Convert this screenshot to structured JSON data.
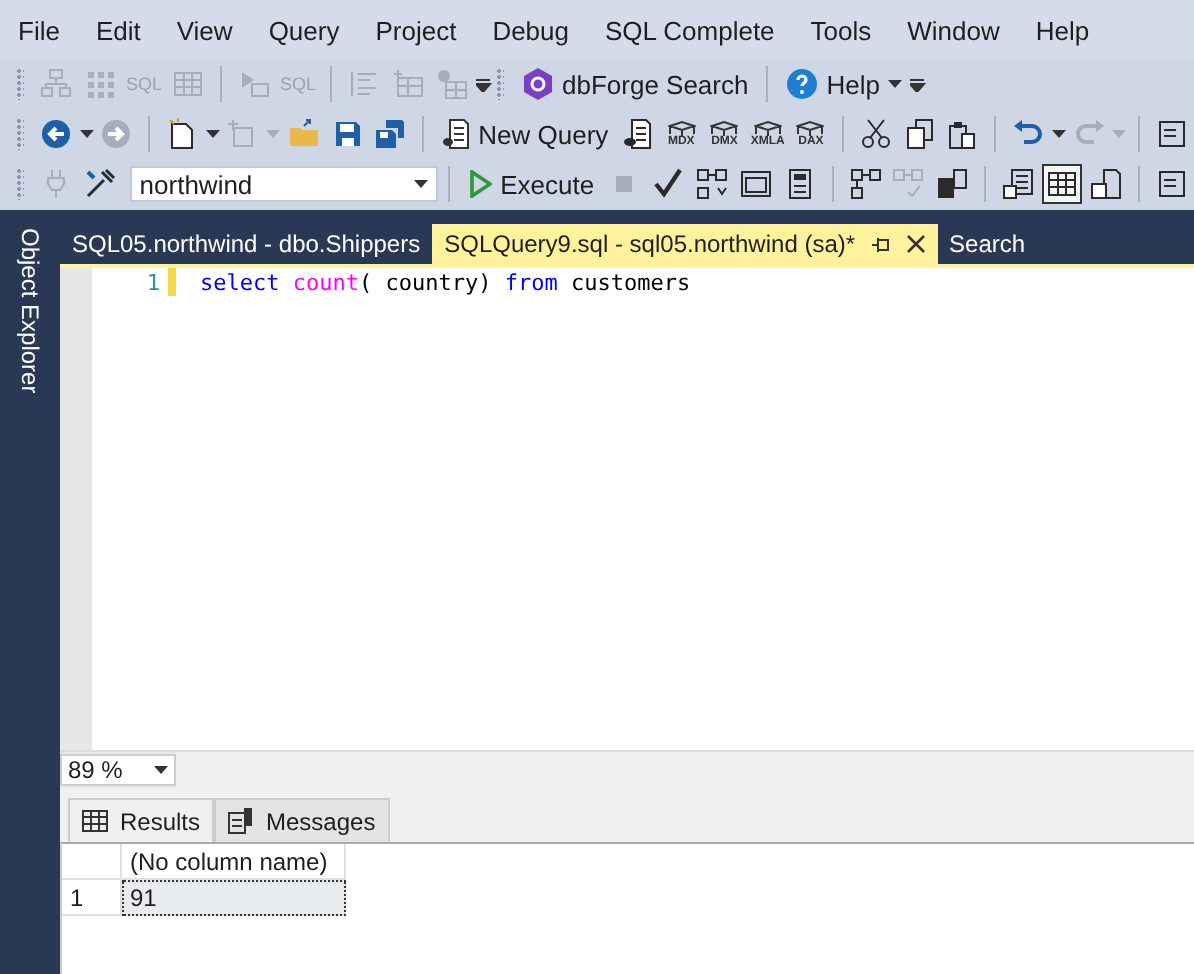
{
  "menu": [
    "File",
    "Edit",
    "View",
    "Query",
    "Project",
    "Debug",
    "SQL Complete",
    "Tools",
    "Window",
    "Help"
  ],
  "toolbars": [
    {
      "items": [
        {
          "kind": "grip"
        },
        {
          "kind": "icon",
          "disabled": true
        },
        {
          "kind": "icon",
          "disabled": true
        },
        {
          "kind": "text-icon",
          "label": "SQL",
          "disabled": true
        },
        {
          "kind": "icon",
          "disabled": true
        },
        {
          "kind": "separator"
        },
        {
          "kind": "icon",
          "disabled": true
        },
        {
          "kind": "text-icon",
          "label": "SQL",
          "disabled": true
        },
        {
          "kind": "separator"
        },
        {
          "kind": "icon",
          "disabled": true
        },
        {
          "kind": "icon",
          "disabled": true
        },
        {
          "kind": "icon",
          "disabled": true
        },
        {
          "kind": "overflow"
        },
        {
          "kind": "grip"
        },
        {
          "kind": "button",
          "label": "dbForge Search",
          "caret": false
        },
        {
          "kind": "separator"
        },
        {
          "kind": "button",
          "label": "Help",
          "caret": true
        },
        {
          "kind": "overflow"
        }
      ]
    },
    {
      "items": [
        {
          "kind": "grip"
        },
        {
          "kind": "icon",
          "disabled": false
        },
        {
          "kind": "caret",
          "disabled": false
        },
        {
          "kind": "icon",
          "disabled": true
        },
        {
          "kind": "separator"
        },
        {
          "kind": "icon",
          "disabled": false
        },
        {
          "kind": "caret",
          "disabled": false
        },
        {
          "kind": "icon",
          "disabled": true
        },
        {
          "kind": "caret",
          "disabled": true
        },
        {
          "kind": "icon",
          "disabled": false
        },
        {
          "kind": "icon",
          "disabled": false
        },
        {
          "kind": "icon",
          "disabled": false
        },
        {
          "kind": "separator"
        },
        {
          "kind": "button",
          "label": "New Query",
          "caret": false
        },
        {
          "kind": "icon",
          "disabled": false
        },
        {
          "kind": "cube-icon",
          "label": "MDX"
        },
        {
          "kind": "cube-icon",
          "label": "DMX"
        },
        {
          "kind": "cube-icon",
          "label": "XMLA"
        },
        {
          "kind": "cube-icon",
          "label": "DAX"
        },
        {
          "kind": "separator"
        },
        {
          "kind": "icon",
          "disabled": false
        },
        {
          "kind": "icon",
          "disabled": false
        },
        {
          "kind": "icon",
          "disabled": false
        },
        {
          "kind": "separator"
        },
        {
          "kind": "icon",
          "disabled": false
        },
        {
          "kind": "caret",
          "disabled": false
        },
        {
          "kind": "icon",
          "disabled": true
        },
        {
          "kind": "caret",
          "disabled": true
        },
        {
          "kind": "separator"
        },
        {
          "kind": "icon",
          "disabled": false
        }
      ]
    },
    {
      "items": [
        {
          "kind": "grip"
        },
        {
          "kind": "icon",
          "disabled": true
        },
        {
          "kind": "icon",
          "disabled": false
        },
        {
          "kind": "dropdown",
          "value": "northwind"
        },
        {
          "kind": "separator"
        },
        {
          "kind": "button",
          "label": "Execute",
          "caret": false
        },
        {
          "kind": "icon",
          "disabled": true
        },
        {
          "kind": "icon",
          "disabled": false
        },
        {
          "kind": "icon",
          "disabled": false
        },
        {
          "kind": "icon",
          "disabled": false
        },
        {
          "kind": "icon",
          "disabled": false
        },
        {
          "kind": "separator"
        },
        {
          "kind": "icon",
          "disabled": false
        },
        {
          "kind": "icon",
          "disabled": true
        },
        {
          "kind": "icon",
          "disabled": false
        },
        {
          "kind": "separator"
        },
        {
          "kind": "icon",
          "disabled": false,
          "selected": false
        },
        {
          "kind": "icon",
          "disabled": false,
          "selected": true
        },
        {
          "kind": "icon",
          "disabled": false,
          "selected": false
        },
        {
          "kind": "separator"
        },
        {
          "kind": "icon",
          "disabled": false
        }
      ]
    }
  ],
  "side_panel": {
    "label": "Object Explorer"
  },
  "tabs": [
    {
      "label": "SQL05.northwind - dbo.Shippers",
      "selected": false
    },
    {
      "label": "SQLQuery9.sql - sql05.northwind (sa)*",
      "selected": true
    },
    {
      "label": "Search",
      "selected": false
    }
  ],
  "editor": {
    "lines": [
      {
        "number": "1",
        "segments": [
          {
            "text": "select ",
            "kind": "keyword"
          },
          {
            "text": "count",
            "kind": "function"
          },
          {
            "text": "( country) ",
            "kind": "plain"
          },
          {
            "text": "from",
            "kind": "keyword"
          },
          {
            "text": " customers",
            "kind": "plain"
          }
        ]
      }
    ]
  },
  "zoom": {
    "value": "89 %"
  },
  "result_tabs": [
    {
      "label": "Results",
      "selected": true
    },
    {
      "label": "Messages",
      "selected": false
    }
  ],
  "results": {
    "columns": [
      "(No column name)"
    ],
    "rows": [
      {
        "number": "1",
        "cells": [
          "91"
        ],
        "selected": true
      }
    ]
  }
}
